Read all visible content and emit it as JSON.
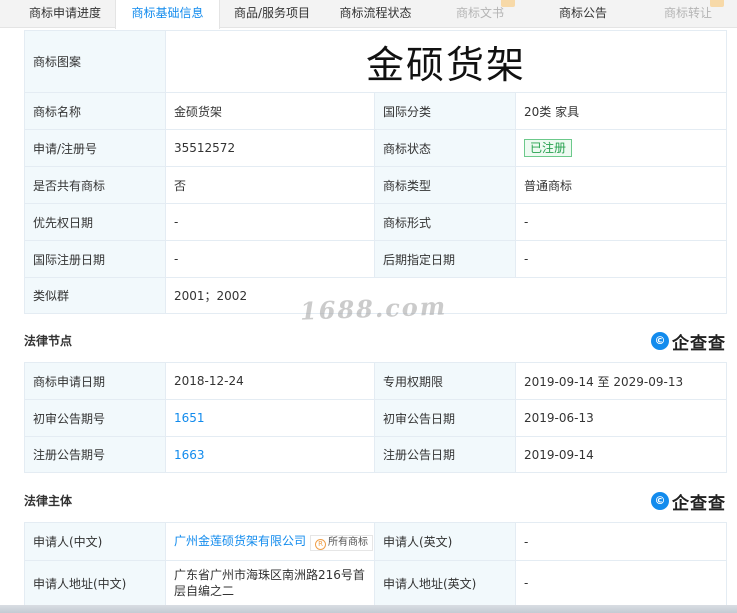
{
  "tabs": [
    {
      "label": "商标申请进度",
      "state": "normal"
    },
    {
      "label": "商标基础信息",
      "state": "active"
    },
    {
      "label": "商品/服务项目",
      "state": "normal"
    },
    {
      "label": "商标流程状态",
      "state": "normal"
    },
    {
      "label": "商标文书",
      "state": "disabled"
    },
    {
      "label": "商标公告",
      "state": "normal"
    },
    {
      "label": "商标转让",
      "state": "disabled"
    }
  ],
  "basic": {
    "image_label": "商标图案",
    "image_text": "金硕货架",
    "name_label": "商标名称",
    "name_value": "金硕货架",
    "intl_class_label": "国际分类",
    "intl_class_value": "20类 家具",
    "reg_no_label": "申请/注册号",
    "reg_no_value": "35512572",
    "status_label": "商标状态",
    "status_value": "已注册",
    "shared_label": "是否共有商标",
    "shared_value": "否",
    "type_label": "商标类型",
    "type_value": "普通商标",
    "priority_date_label": "优先权日期",
    "priority_date_value": "-",
    "form_label": "商标形式",
    "form_value": "-",
    "intl_reg_date_label": "国际注册日期",
    "intl_reg_date_value": "-",
    "later_designation_label": "后期指定日期",
    "later_designation_value": "-",
    "similar_group_label": "类似群",
    "similar_group_value": "2001；2002"
  },
  "watermark": "1688.com",
  "legal_nodes": {
    "title": "法律节点",
    "apply_date_label": "商标申请日期",
    "apply_date_value": "2018-12-24",
    "exclusive_period_label": "专用权期限",
    "exclusive_period_value": "2019-09-14 至 2029-09-13",
    "prelim_issue_label": "初审公告期号",
    "prelim_issue_value": "1651",
    "prelim_date_label": "初审公告日期",
    "prelim_date_value": "2019-06-13",
    "reg_issue_label": "注册公告期号",
    "reg_issue_value": "1663",
    "reg_date_label": "注册公告日期",
    "reg_date_value": "2019-09-14"
  },
  "legal_subject": {
    "title": "法律主体",
    "applicant_cn_label": "申请人(中文)",
    "applicant_cn_value": "广州金莲硕货架有限公司",
    "owner_tag": "所有商标",
    "applicant_en_label": "申请人(英文)",
    "applicant_en_value": "-",
    "address_cn_label": "申请人地址(中文)",
    "address_cn_value": "广东省广州市海珠区南洲路216号首层自编之二",
    "address_en_label": "申请人地址(英文)",
    "address_en_value": "-"
  },
  "brand": {
    "logo_mark": "©",
    "logo_text": "企查查"
  },
  "colors": {
    "accent": "#128bed",
    "label_bg": "#f2f9fc",
    "border": "#e4ecf3",
    "status_green": "#27a14f"
  }
}
